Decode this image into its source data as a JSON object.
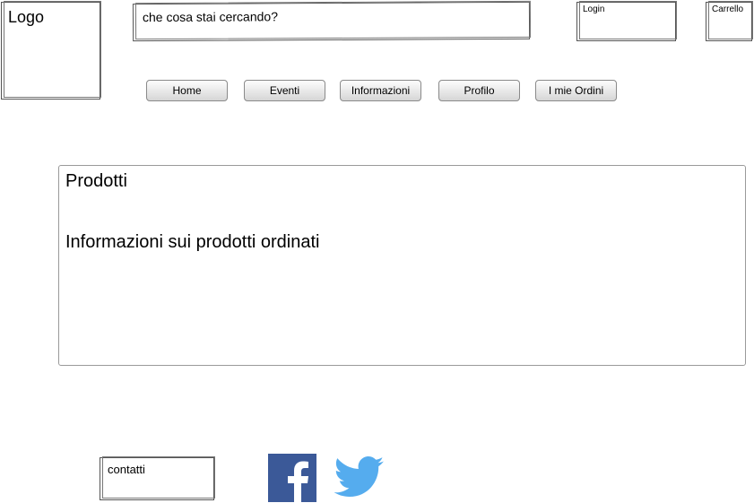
{
  "header": {
    "logo_label": "Logo",
    "search_placeholder": "che cosa stai cercando?",
    "login_label": "Login",
    "cart_label": "Carrello"
  },
  "nav": {
    "items": [
      {
        "label": "Home"
      },
      {
        "label": "Eventi"
      },
      {
        "label": "Informazioni"
      },
      {
        "label": "Profilo"
      },
      {
        "label": "I mie Ordini"
      }
    ]
  },
  "main": {
    "title": "Prodotti",
    "description": "Informazioni sui prodotti ordinati"
  },
  "footer": {
    "contact_label": "contatti",
    "social": [
      {
        "icon": "facebook-icon",
        "color": "#3b5998"
      },
      {
        "icon": "twitter-icon",
        "color": "#55acee"
      }
    ]
  }
}
